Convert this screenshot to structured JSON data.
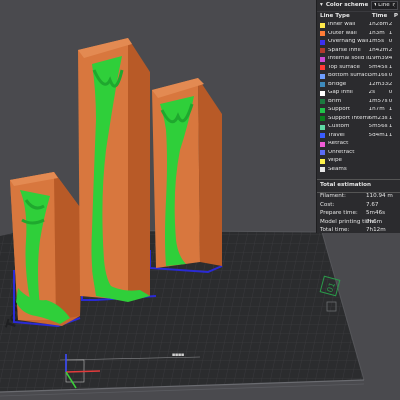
{
  "legend_panel": {
    "title": "Color scheme",
    "view_select": "Line Type",
    "columns": {
      "type": "Line Type",
      "time": "Time",
      "percent": "P"
    },
    "items": [
      {
        "name": "Inner wall",
        "time": "1h28m",
        "percent": "2",
        "color": "#ffe84a"
      },
      {
        "name": "Outer wall",
        "time": "1h3m",
        "percent": "1",
        "color": "#ff7d38"
      },
      {
        "name": "Overhang wall",
        "time": "1m5s",
        "percent": "0",
        "color": "#3b2ff2"
      },
      {
        "name": "Sparse infill",
        "time": "1h42m",
        "percent": "2",
        "color": "#b13a2e"
      },
      {
        "name": "Internal solid infill",
        "time": "19m39s",
        "percent": "4",
        "color": "#c94bd6"
      },
      {
        "name": "Top surface",
        "time": "5m45s",
        "percent": "1",
        "color": "#ff3a36"
      },
      {
        "name": "Bottom surface",
        "time": "3m16s",
        "percent": "0",
        "color": "#6e9eff"
      },
      {
        "name": "Bridge",
        "time": "12m33s",
        "percent": "2",
        "color": "#3e8bbd"
      },
      {
        "name": "Gap infill",
        "time": "2s",
        "percent": "0",
        "color": "#ffffff"
      },
      {
        "name": "Brim",
        "time": "1m57s",
        "percent": "0",
        "color": "#1c7a3f"
      },
      {
        "name": "Support",
        "time": "1h7m",
        "percent": "1",
        "color": "#22c34a"
      },
      {
        "name": "Support interface",
        "time": "6m23s",
        "percent": "1",
        "color": "#0a7f1d"
      },
      {
        "name": "Custom",
        "time": "5m56s",
        "percent": "1",
        "color": "#5ed9a4"
      },
      {
        "name": "Travel",
        "time": "5d4m17s",
        "percent": "1",
        "color": "#3a5cff"
      },
      {
        "name": "Retract",
        "time": "",
        "percent": "",
        "color": "#f25bd6"
      },
      {
        "name": "Unretract",
        "time": "",
        "percent": "",
        "color": "#5b6cf7"
      },
      {
        "name": "Wipe",
        "time": "",
        "percent": "",
        "color": "#fff34a"
      },
      {
        "name": "Seams",
        "time": "",
        "percent": "",
        "color": "#e7e7e7"
      }
    ]
  },
  "estimation": {
    "title": "Total estimation",
    "rows": [
      {
        "key": "Filament:",
        "value": "110.94 m"
      },
      {
        "key": "Cost:",
        "value": "7.67"
      },
      {
        "key": "Prepare time:",
        "value": "5m46s"
      },
      {
        "key": "Model printing time:",
        "value": "7h6m"
      },
      {
        "key": "Total time:",
        "value": "7h12m"
      }
    ]
  },
  "plate": {
    "label": "Textured PEI Plate",
    "number": "01"
  },
  "colors": {
    "background": "#4a4a4e",
    "plate": "#2b2c2e",
    "grid": "#3c3d40",
    "model": "#d8773e",
    "support": "#2fcf3a",
    "support_interface": "#1fa82e",
    "outline": "#2a2ad6"
  }
}
